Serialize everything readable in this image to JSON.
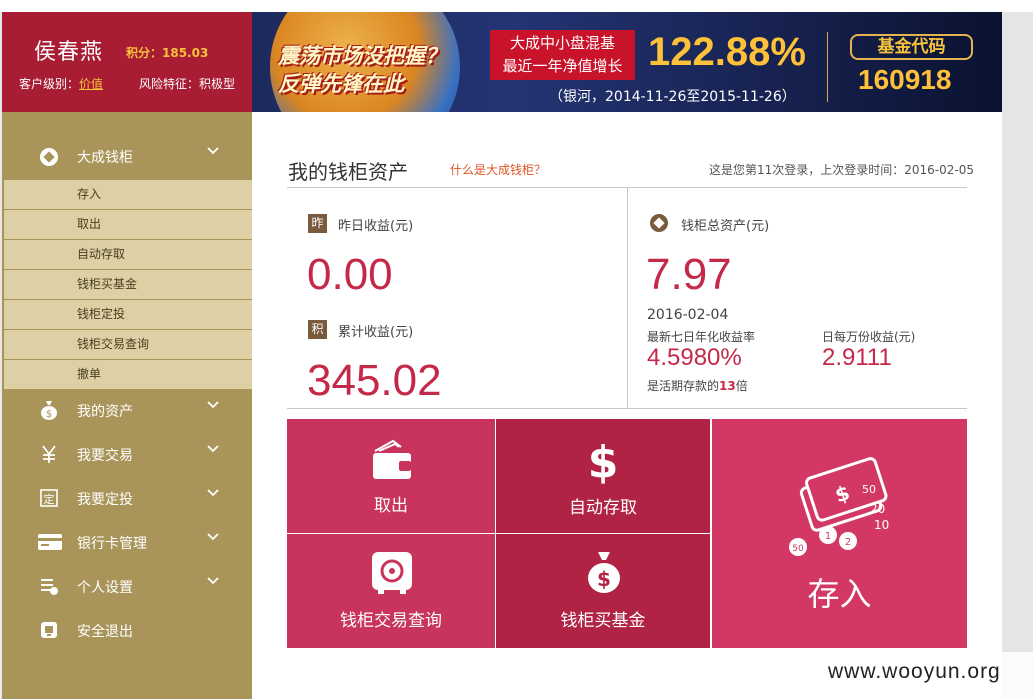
{
  "user": {
    "name": "侯春燕",
    "score_label": "积分：185.03",
    "level_label": "客户级别：",
    "level_value": "价值",
    "risk_label": "风险特征：",
    "risk_value": "积极型"
  },
  "sidebar": {
    "section": {
      "label": "大成钱柜",
      "icon": "diamond-icon"
    },
    "subitems": [
      "存入",
      "取出",
      "自动存取",
      "钱柜买基金",
      "钱柜定投",
      "钱柜交易查询",
      "撤单"
    ],
    "items": [
      {
        "label": "我的资产",
        "icon": "moneybag-icon",
        "has_chevron": true
      },
      {
        "label": "我要交易",
        "icon": "yen-icon",
        "has_chevron": true
      },
      {
        "label": "我要定投",
        "icon": "fixed-invest-icon",
        "has_chevron": true
      },
      {
        "label": "银行卡管理",
        "icon": "card-icon",
        "has_chevron": true
      },
      {
        "label": "个人设置",
        "icon": "settings-list-icon",
        "has_chevron": true
      },
      {
        "label": "安全退出",
        "icon": "logout-icon",
        "has_chevron": false
      }
    ]
  },
  "banner": {
    "slogan_line1": "震荡市场没把握？",
    "slogan_line2": "反弹先锋在此",
    "fund_line1": "大成中小盘混基",
    "fund_line2": "最近一年净值增长",
    "growth": "122.88%",
    "period": "（银河，2014-11-26至2015-11-26）",
    "code_label": "基金代码",
    "code": "160918"
  },
  "main": {
    "title": "我的钱柜资产",
    "what_link": "什么是大成钱柜？",
    "login_info": "这是您第11次登录，上次登录时间：2016-02-05",
    "yesterday_tag": "昨",
    "yesterday_label": "昨日收益(元)",
    "yesterday_value": "0.00",
    "total_tag": "积",
    "total_label": "累计收益(元)",
    "total_value": "345.02",
    "assets_label": "钱柜总资产(元)",
    "assets_value": "7.97",
    "assets_date": "2016-02-04",
    "yield_label": "最新七日年化收益率",
    "yield_value": "4.5980%",
    "yield_note_prefix": "是活期存款的",
    "yield_note_num": "13",
    "yield_note_suffix": "倍",
    "daily_label": "日每万份收益(元)",
    "daily_value": "2.9111"
  },
  "tiles": {
    "withdraw": "取出",
    "auto": "自动存取",
    "query": "钱柜交易查询",
    "buyfund": "钱柜买基金",
    "deposit": "存入"
  },
  "watermark": "www.wooyun.org",
  "colors": {
    "sidebar": "#a9955a",
    "user_header": "#a81c34",
    "accent": "#c4294a",
    "tile_light": "#c9345d",
    "tile_dark": "#b02344"
  }
}
